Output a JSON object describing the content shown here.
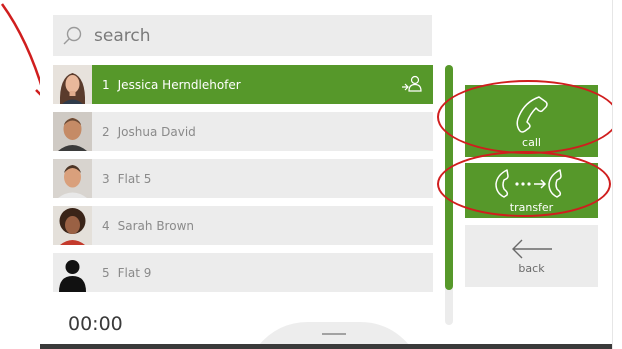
{
  "search": {
    "placeholder": "search",
    "icon": "search-icon"
  },
  "contacts": [
    {
      "number": "1",
      "name": "Jessica Herndlehofer",
      "active": true
    },
    {
      "number": "2",
      "name": "Joshua David",
      "active": false
    },
    {
      "number": "3",
      "name": "Flat 5",
      "active": false
    },
    {
      "number": "4",
      "name": "Sarah Brown",
      "active": false
    },
    {
      "number": "5",
      "name": "Flat 9",
      "active": false
    }
  ],
  "actions": {
    "call_label": "call",
    "transfer_label": "transfer",
    "back_label": "back"
  },
  "timer": "00:00",
  "colors": {
    "accent_green": "#56982a",
    "row_gray": "#ececec",
    "highlight_red": "#d01e1e"
  }
}
